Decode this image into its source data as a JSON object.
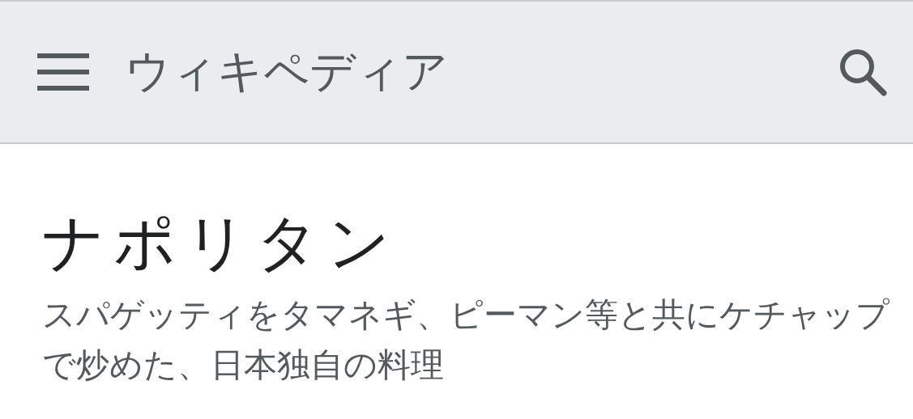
{
  "header": {
    "title": "ウィキペディア"
  },
  "article": {
    "title": "ナポリタン",
    "description": "スパゲッティをタマネギ、ピーマン等と共にケチャップで炒めた、日本独自の料理"
  }
}
